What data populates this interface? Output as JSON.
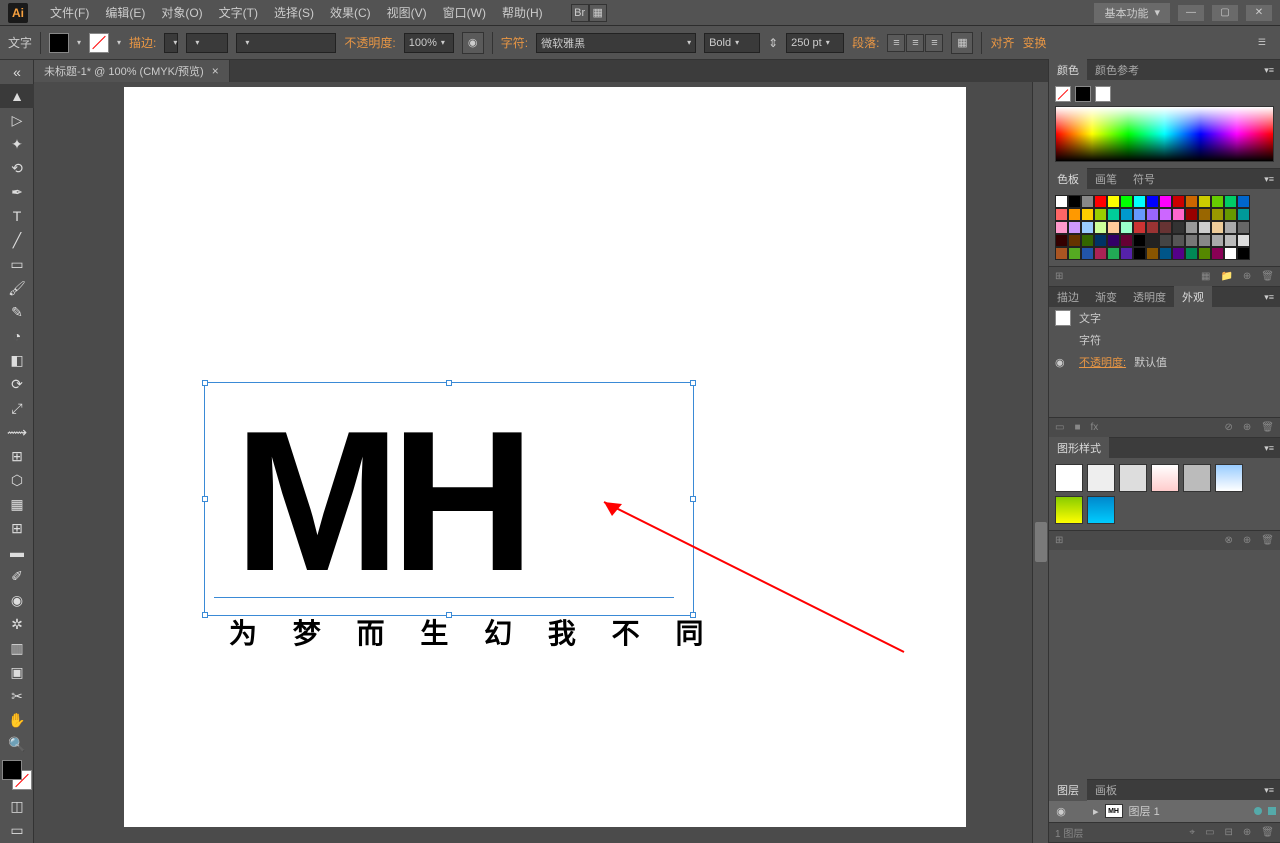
{
  "menubar": {
    "items": [
      "文件(F)",
      "编辑(E)",
      "对象(O)",
      "文字(T)",
      "选择(S)",
      "效果(C)",
      "视图(V)",
      "窗口(W)",
      "帮助(H)"
    ],
    "workspace": "基本功能"
  },
  "controlbar": {
    "tool_label": "文字",
    "stroke_label": "描边:",
    "opacity_label": "不透明度:",
    "opacity_value": "100%",
    "char_label": "字符:",
    "font_family": "微软雅黑",
    "font_weight": "Bold",
    "font_size": "250 pt",
    "para_label": "段落:",
    "align_label": "对齐",
    "transform_label": "变换"
  },
  "document": {
    "tab_title": "未标题-1* @ 100% (CMYK/预览)",
    "main_text": "MH",
    "sub_text": "为 梦 而 生   幻 我 不 同"
  },
  "panels": {
    "color": {
      "tab1": "颜色",
      "tab2": "颜色参考"
    },
    "swatches": {
      "tab1": "色板",
      "tab2": "画笔",
      "tab3": "符号"
    },
    "appearance": {
      "tab1": "描边",
      "tab2": "渐变",
      "tab3": "透明度",
      "tab4": "外观",
      "row1": "文字",
      "row2": "字符",
      "row3_label": "不透明度:",
      "row3_value": "默认值"
    },
    "graphic_styles": {
      "tab": "图形样式"
    },
    "layers": {
      "tab1": "图层",
      "tab2": "画板",
      "layer_name": "图层 1",
      "count": "1 图层"
    }
  }
}
